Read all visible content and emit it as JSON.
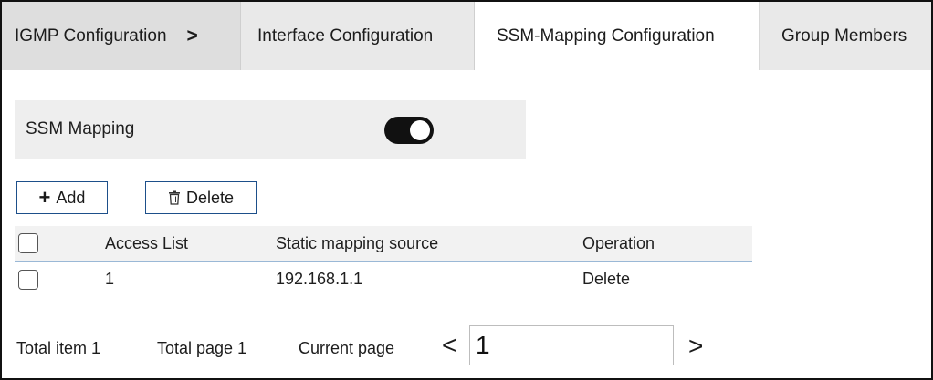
{
  "tabs": [
    {
      "label": "IGMP Configuration",
      "separator": ">"
    },
    {
      "label": "Interface Configuration"
    },
    {
      "label": "SSM-Mapping Configuration",
      "active": true
    },
    {
      "label": "Group Members"
    }
  ],
  "ssm_mapping": {
    "label": "SSM Mapping",
    "enabled": true
  },
  "toolbar": {
    "add_label": "Add",
    "delete_label": "Delete"
  },
  "table": {
    "columns": [
      "Access List",
      "Static mapping source",
      "Operation"
    ],
    "rows": [
      {
        "access_list": "1",
        "source": "192.168.1.1",
        "operation": "Delete"
      }
    ]
  },
  "pager": {
    "total_item": "Total item 1",
    "total_page": "Total page 1",
    "current_page_label": "Current page",
    "current_page_value": "1",
    "prev": "<",
    "next": ">"
  },
  "colors": {
    "tab_inactive": "#e9e9e9",
    "tab_active": "#ffffff",
    "button_border": "#1d4f8a",
    "header_underline": "#9ab8d6",
    "toggle_on": "#111111"
  }
}
